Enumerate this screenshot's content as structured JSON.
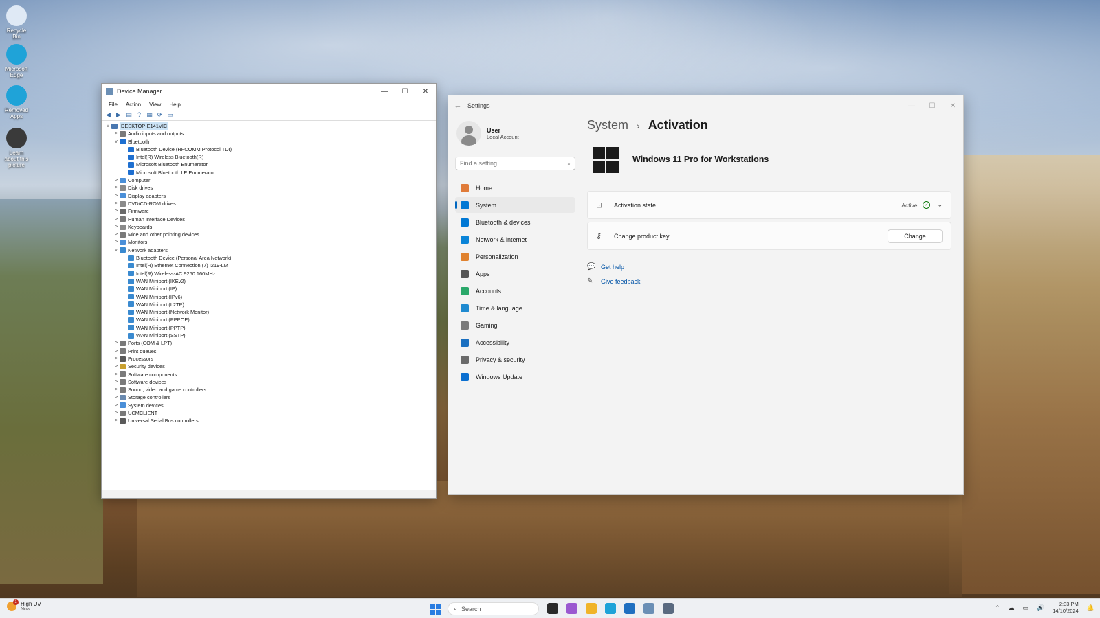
{
  "desktop": {
    "icons": [
      {
        "label": "Recycle Bin",
        "icon": "recycle-bin-icon",
        "color": "#dfe9f5"
      },
      {
        "label": "Microsoft Edge",
        "icon": "edge-icon",
        "color": "#1fa3d8"
      },
      {
        "label": "Removed Apps",
        "icon": "edge-icon",
        "color": "#1fa3d8"
      },
      {
        "label": "Learn about this picture",
        "icon": "camera-icon",
        "color": "#3a3a3a"
      }
    ]
  },
  "device_manager": {
    "title": "Device Manager",
    "menu": [
      "File",
      "Action",
      "View",
      "Help"
    ],
    "tree": [
      {
        "level": 0,
        "exp": "v",
        "label": "DESKTOP-E141VIC",
        "color": "#4a78b0",
        "root": true
      },
      {
        "level": 1,
        "exp": ">",
        "label": "Audio inputs and outputs",
        "color": "#7a7a7a"
      },
      {
        "level": 1,
        "exp": "v",
        "label": "Bluetooth",
        "color": "#1e6fd0"
      },
      {
        "level": 2,
        "exp": "",
        "label": "Bluetooth Device (RFCOMM Protocol TDI)",
        "color": "#1e6fd0"
      },
      {
        "level": 2,
        "exp": "",
        "label": "Intel(R) Wireless Bluetooth(R)",
        "color": "#1e6fd0"
      },
      {
        "level": 2,
        "exp": "",
        "label": "Microsoft Bluetooth Enumerator",
        "color": "#1e6fd0"
      },
      {
        "level": 2,
        "exp": "",
        "label": "Microsoft Bluetooth LE Enumerator",
        "color": "#1e6fd0"
      },
      {
        "level": 1,
        "exp": ">",
        "label": "Computer",
        "color": "#4a8fd8"
      },
      {
        "level": 1,
        "exp": ">",
        "label": "Disk drives",
        "color": "#8a8a8a"
      },
      {
        "level": 1,
        "exp": ">",
        "label": "Display adapters",
        "color": "#4a8fd8"
      },
      {
        "level": 1,
        "exp": ">",
        "label": "DVD/CD-ROM drives",
        "color": "#8a8a8a"
      },
      {
        "level": 1,
        "exp": ">",
        "label": "Firmware",
        "color": "#6a6a6a"
      },
      {
        "level": 1,
        "exp": ">",
        "label": "Human Interface Devices",
        "color": "#7a7a7a"
      },
      {
        "level": 1,
        "exp": ">",
        "label": "Keyboards",
        "color": "#8a8a8a"
      },
      {
        "level": 1,
        "exp": ">",
        "label": "Mice and other pointing devices",
        "color": "#7a7a7a"
      },
      {
        "level": 1,
        "exp": ">",
        "label": "Monitors",
        "color": "#4a8fd8"
      },
      {
        "level": 1,
        "exp": "v",
        "label": "Network adapters",
        "color": "#3a8ad0"
      },
      {
        "level": 2,
        "exp": "",
        "label": "Bluetooth Device (Personal Area Network)",
        "color": "#3a8ad0"
      },
      {
        "level": 2,
        "exp": "",
        "label": "Intel(R) Ethernet Connection (7) I219-LM",
        "color": "#3a8ad0"
      },
      {
        "level": 2,
        "exp": "",
        "label": "Intel(R) Wireless-AC 9260 160MHz",
        "color": "#3a8ad0"
      },
      {
        "level": 2,
        "exp": "",
        "label": "WAN Miniport (IKEv2)",
        "color": "#3a8ad0"
      },
      {
        "level": 2,
        "exp": "",
        "label": "WAN Miniport (IP)",
        "color": "#3a8ad0"
      },
      {
        "level": 2,
        "exp": "",
        "label": "WAN Miniport (IPv6)",
        "color": "#3a8ad0"
      },
      {
        "level": 2,
        "exp": "",
        "label": "WAN Miniport (L2TP)",
        "color": "#3a8ad0"
      },
      {
        "level": 2,
        "exp": "",
        "label": "WAN Miniport (Network Monitor)",
        "color": "#3a8ad0"
      },
      {
        "level": 2,
        "exp": "",
        "label": "WAN Miniport (PPPOE)",
        "color": "#3a8ad0"
      },
      {
        "level": 2,
        "exp": "",
        "label": "WAN Miniport (PPTP)",
        "color": "#3a8ad0"
      },
      {
        "level": 2,
        "exp": "",
        "label": "WAN Miniport (SSTP)",
        "color": "#3a8ad0"
      },
      {
        "level": 1,
        "exp": ">",
        "label": "Ports (COM & LPT)",
        "color": "#7a7a7a"
      },
      {
        "level": 1,
        "exp": ">",
        "label": "Print queues",
        "color": "#7a7a7a"
      },
      {
        "level": 1,
        "exp": ">",
        "label": "Processors",
        "color": "#5a5a5a"
      },
      {
        "level": 1,
        "exp": ">",
        "label": "Security devices",
        "color": "#c8a030"
      },
      {
        "level": 1,
        "exp": ">",
        "label": "Software components",
        "color": "#7a7a7a"
      },
      {
        "level": 1,
        "exp": ">",
        "label": "Software devices",
        "color": "#7a7a7a"
      },
      {
        "level": 1,
        "exp": ">",
        "label": "Sound, video and game controllers",
        "color": "#7a7a7a"
      },
      {
        "level": 1,
        "exp": ">",
        "label": "Storage controllers",
        "color": "#6a8ab0"
      },
      {
        "level": 1,
        "exp": ">",
        "label": "System devices",
        "color": "#4a8fd8"
      },
      {
        "level": 1,
        "exp": ">",
        "label": "UCMCLIENT",
        "color": "#7a7a7a"
      },
      {
        "level": 1,
        "exp": ">",
        "label": "Universal Serial Bus controllers",
        "color": "#5a5a5a"
      }
    ]
  },
  "settings": {
    "title": "Settings",
    "user": {
      "name": "User",
      "account": "Local Account"
    },
    "search_placeholder": "Find a setting",
    "nav": [
      {
        "label": "Home",
        "icon": "home-icon",
        "color": "#e07b39",
        "active": false
      },
      {
        "label": "System",
        "icon": "system-icon",
        "color": "#0078d4",
        "active": true
      },
      {
        "label": "Bluetooth & devices",
        "icon": "bluetooth-icon",
        "color": "#0078d4",
        "active": false
      },
      {
        "label": "Network & internet",
        "icon": "wifi-icon",
        "color": "#0a84d8",
        "active": false
      },
      {
        "label": "Personalization",
        "icon": "brush-icon",
        "color": "#e0822f",
        "active": false
      },
      {
        "label": "Apps",
        "icon": "apps-icon",
        "color": "#555555",
        "active": false
      },
      {
        "label": "Accounts",
        "icon": "accounts-icon",
        "color": "#2aa86a",
        "active": false
      },
      {
        "label": "Time & language",
        "icon": "globe-icon",
        "color": "#1f8ad0",
        "active": false
      },
      {
        "label": "Gaming",
        "icon": "gamepad-icon",
        "color": "#7a7a7a",
        "active": false
      },
      {
        "label": "Accessibility",
        "icon": "accessibility-icon",
        "color": "#1a6fc0",
        "active": false
      },
      {
        "label": "Privacy & security",
        "icon": "shield-icon",
        "color": "#6a6a6a",
        "active": false
      },
      {
        "label": "Windows Update",
        "icon": "update-icon",
        "color": "#0a6fd0",
        "active": false
      }
    ],
    "breadcrumb": {
      "parent": "System",
      "sep": "›",
      "current": "Activation"
    },
    "edition": "Windows 11 Pro for Workstations",
    "activation": {
      "label": "Activation state",
      "state": "Active",
      "state_color": "#0f7b0f"
    },
    "product_key": {
      "label": "Change product key",
      "button": "Change"
    },
    "links": {
      "help": "Get help",
      "feedback": "Give feedback"
    }
  },
  "taskbar": {
    "weather": {
      "title": "High UV",
      "sub": "Now"
    },
    "search_placeholder": "Search",
    "apps": [
      {
        "name": "task-view-icon",
        "color": "#2a2a2a"
      },
      {
        "name": "copilot-icon",
        "color": "#9b59d0"
      },
      {
        "name": "file-explorer-icon",
        "color": "#f0b429"
      },
      {
        "name": "edge-icon",
        "color": "#1fa3d8"
      },
      {
        "name": "store-icon",
        "color": "#1f6fc0"
      },
      {
        "name": "device-manager-icon",
        "color": "#6b8fb5"
      },
      {
        "name": "settings-icon",
        "color": "#5a6a80"
      }
    ],
    "time": "2:33 PM",
    "date": "14/10/2024"
  }
}
